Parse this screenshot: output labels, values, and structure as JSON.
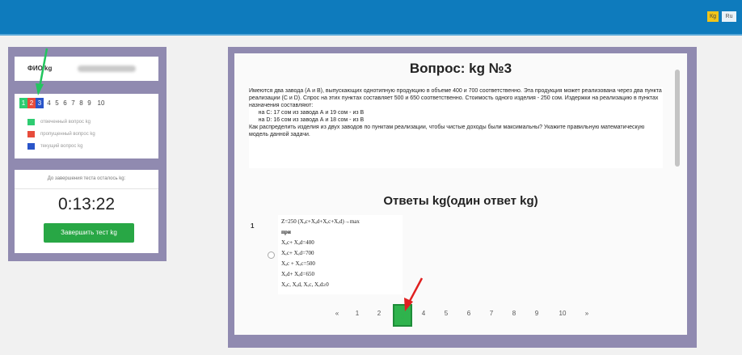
{
  "header": {
    "lang_kg": "Кg",
    "lang_ru": "Ru"
  },
  "fio": {
    "label": "ФИО kg"
  },
  "nav": {
    "questions": [
      "1",
      "2",
      "3",
      "4",
      "5",
      "6",
      "7",
      "8",
      "9",
      "10"
    ],
    "answered": "1",
    "skipped": "2",
    "current": "3",
    "legend": [
      {
        "color": "#2ecc71",
        "label": "отвеченный вопрос kg"
      },
      {
        "color": "#e74c3c",
        "label": "пропущенный вопрос kg"
      },
      {
        "color": "#2a55c9",
        "label": "текущий вопрос kg"
      }
    ]
  },
  "timer": {
    "label": "До завершения теста осталось kg:",
    "value": "0:13:22",
    "finish_label": "Завершить тест kg"
  },
  "question": {
    "title": "Вопрос: kg №3",
    "text": "Имеются два завода (А и В), выпускающих однотипную продукцию в объеме 400 и 700 соответственно. Эта продукция может реализована через два пункта реализации (С и D). Спрос на этих пунктах составляет 500 и 650 соответственно. Стоимость одного изделия - 250 сом. Издержки на реализацию в пунктах назначения составляют:\n      на С: 17 сом из завода А и 19 сом - из В\n      на D: 16 сом из завода А и 18 сом - из В\nКак распределить изделия из двух заводов по пунктам реализации, чтобы чистые доходы были максимальны? Укажите правильную математическую модель данной задачи."
  },
  "answers": {
    "title": "Ответы kg(один ответ kg)",
    "index": "1",
    "option_lines": [
      "Z=250 (Xₐc+Xₐd+Xₑc+Xₑd)→max",
      "при",
      "Xₐc+ Xₐd=400",
      "Xₑc+ Xₑd=700",
      "Xₐc + Xₑc=500",
      "Xₐd+ Xₑd=650",
      "Xₐc, Xₐd, Xₑc, Xₑd≥0"
    ]
  },
  "pager": {
    "prev": "«",
    "pages": [
      "1",
      "2",
      "3",
      "4",
      "5",
      "6",
      "7",
      "8",
      "9",
      "10"
    ],
    "next": "»",
    "active": "3"
  },
  "colors": {
    "topbar": "#0e7bbd",
    "panel_frame": "#908ab0",
    "accent_green": "#28a745",
    "annotation_red": "#e02020",
    "annotation_green": "#22c55e"
  }
}
